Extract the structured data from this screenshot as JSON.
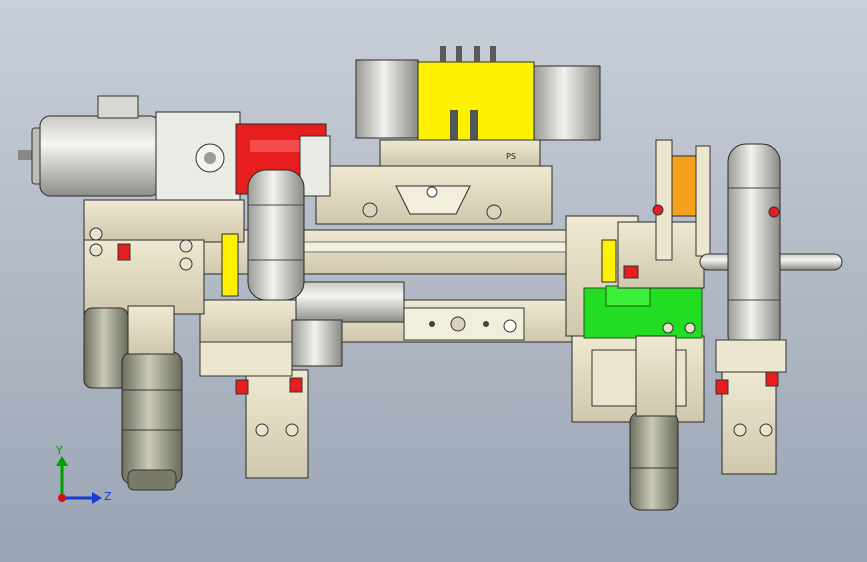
{
  "viewport": {
    "background_top": "#c9cfd8",
    "background_bottom": "#9aa4b3"
  },
  "model": {
    "part_tag": "PS",
    "colors": {
      "beige": "#e3ddc4",
      "beige_dark": "#b8b197",
      "gray_cylinder": "#d4d4d0",
      "gray_dark": "#9a9a96",
      "valve_yellow": "#fff200",
      "motor_red": "#e81d1d",
      "bracket_green": "#22dd22",
      "cylinder_orange": "#f4a21c",
      "dark_motor": "#8f8f7c",
      "outline": "#2a2a2a"
    }
  },
  "triad": {
    "y_label": "Y",
    "z_label": "Z",
    "y_color": "#00a000",
    "z_color": "#1a3cd6",
    "origin_color": "#d01010"
  }
}
